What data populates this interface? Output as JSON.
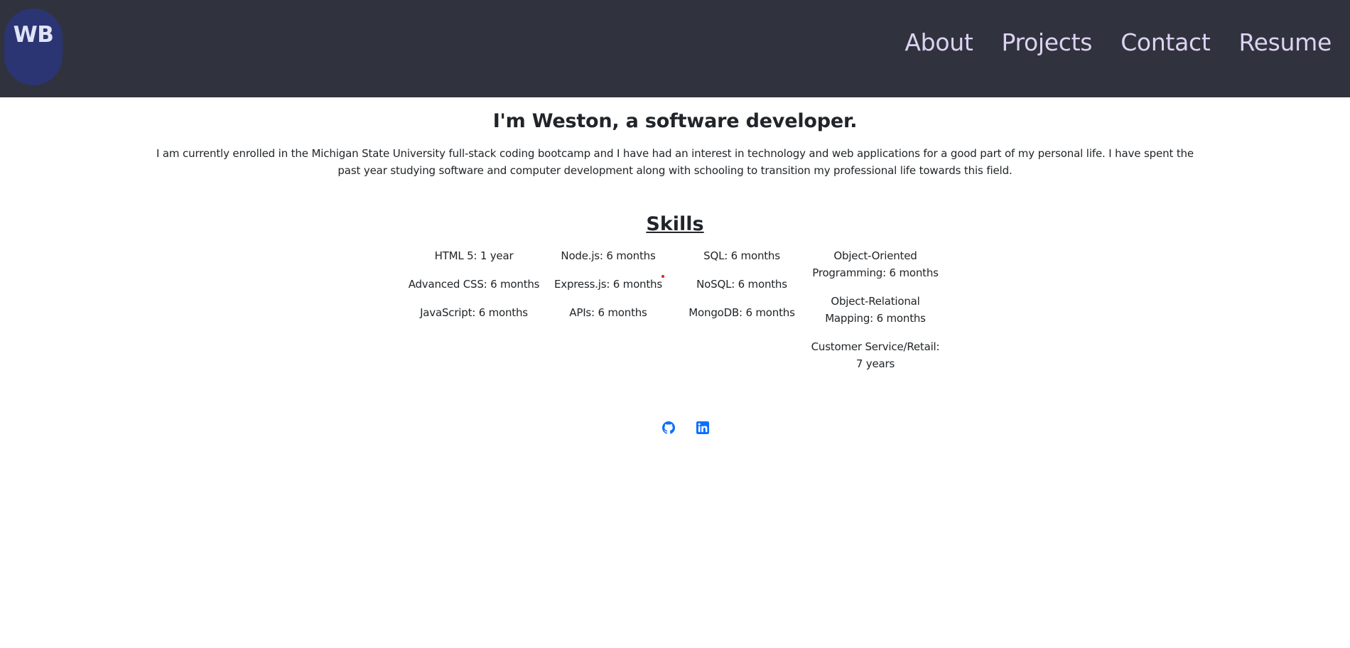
{
  "header": {
    "logo_text": "WB",
    "nav": [
      {
        "label": "About"
      },
      {
        "label": "Projects"
      },
      {
        "label": "Contact"
      },
      {
        "label": "Resume"
      }
    ]
  },
  "hero": {
    "title": "I'm Weston, a software developer.",
    "paragraph": "I am currently enrolled in the Michigan State University full-stack coding bootcamp and I have had an interest in technology and web applications for a good part of my personal life. I have spent the past year studying software and computer development along with schooling to transition my professional life towards this field."
  },
  "skills": {
    "title": "Skills",
    "columns": [
      [
        "HTML 5: 1 year",
        "Advanced CSS: 6 months",
        "JavaScript: 6 months"
      ],
      [
        "Node.js: 6 months",
        "Express.js: 6 months",
        "APIs: 6 months"
      ],
      [
        "SQL: 6 months",
        "NoSQL: 6 months",
        "MongoDB: 6 months"
      ],
      [
        "Object-Oriented Programming: 6 months",
        "Object-Relational Mapping: 6 months",
        "Customer Service/Retail: 7 years"
      ]
    ]
  },
  "social": {
    "icons": [
      "github-icon",
      "linkedin-icon"
    ]
  },
  "colors": {
    "navbar": "#30333d",
    "logo_bg": "#2b3573",
    "nav_text": "#dcd2f3",
    "icon_blue": "#0d6efd"
  }
}
